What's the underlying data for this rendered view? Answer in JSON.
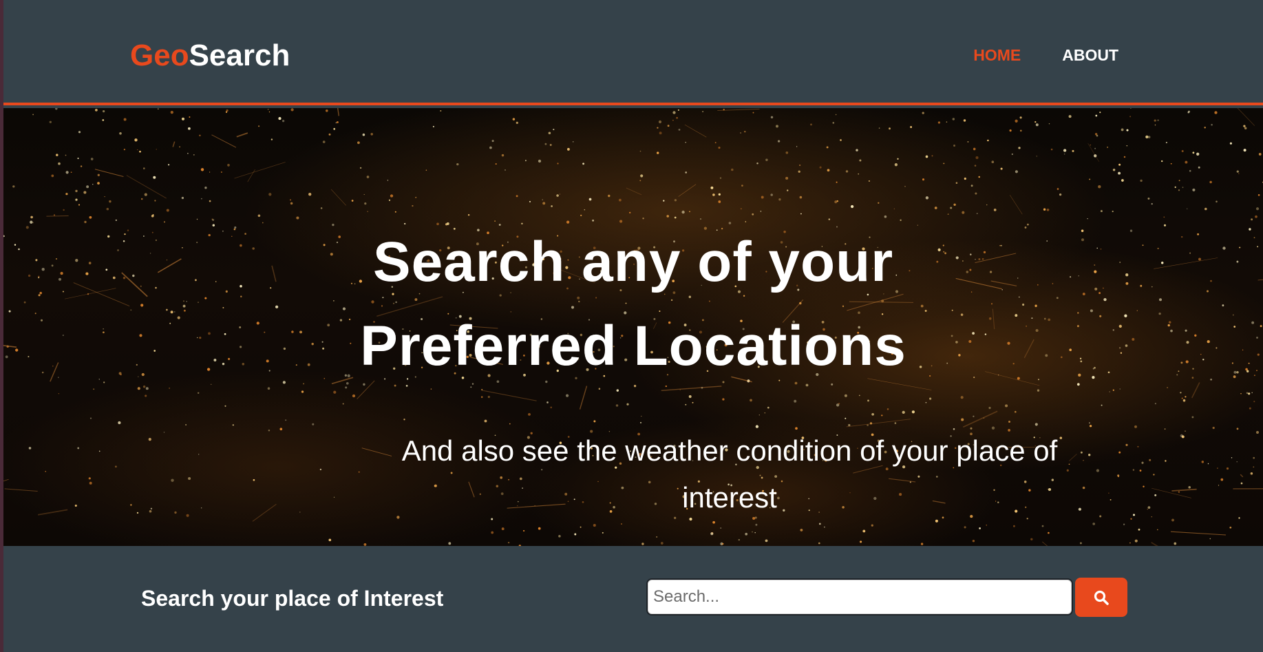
{
  "header": {
    "logo_accent": "Geo",
    "logo_main": "Search",
    "nav": [
      {
        "label": "HOME",
        "active": true
      },
      {
        "label": "ABOUT",
        "active": false
      }
    ]
  },
  "hero": {
    "title": "Search any of your Preferred Locations",
    "subtitle": "And also see the weather condition of your place of interest"
  },
  "search": {
    "label": "Search your place of Interest",
    "placeholder": "Search...",
    "value": "",
    "button_icon": "search-icon"
  },
  "colors": {
    "accent": "#e8491d",
    "header_bg": "#35424a",
    "text": "#ffffff"
  }
}
